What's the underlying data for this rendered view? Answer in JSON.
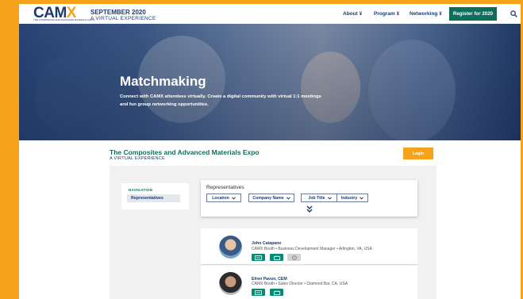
{
  "header": {
    "logo_text": "CAMX",
    "logo_tagline": "THE COMPOSITES AND ADVANCED MATERIALS EXPO",
    "event_title": "SEPTEMBER 2020",
    "event_subtitle": "A VIRTUAL EXPERIENCE",
    "nav": [
      {
        "label": "About",
        "icon": "chevron-double-down"
      },
      {
        "label": "Program",
        "icon": "chevron-double-down"
      },
      {
        "label": "Networking",
        "icon": "chevron-double-down"
      }
    ],
    "register_label": "Register for 2020",
    "search_icon": "search-icon"
  },
  "hero": {
    "title": "Matchmaking",
    "description": "Connect with CAMX attendees virtually. Create a digital community with virtual 1:1 meetings and fun group networking opportunities."
  },
  "expo": {
    "title": "The Composites and Advanced Materials Expo",
    "subtitle": "A VIRTUAL EXPERIENCE",
    "login_label": "Login"
  },
  "navigation": {
    "heading": "NAVIGATION",
    "items": [
      "Representatives"
    ]
  },
  "filters": {
    "title": "Representatives",
    "buttons": [
      "Location",
      "Company Name",
      "Job Title",
      "Industry"
    ]
  },
  "representatives": [
    {
      "name": "John Catapano",
      "info": "CAMX Booth • Business Development Manager • Arlington, VA, USA",
      "actions": [
        "video-chat-icon",
        "booth-icon",
        "schedule-icon"
      ]
    },
    {
      "name": "Efren Pavon, CEM",
      "info": "CAMX Booth • Sales Director • Diamond Bar, CA, USA",
      "actions": [
        "video-chat-icon",
        "booth-icon"
      ]
    }
  ],
  "colors": {
    "brand_navy": "#1e3a6e",
    "brand_orange": "#f6a21a",
    "brand_teal": "#0b6f5c"
  }
}
